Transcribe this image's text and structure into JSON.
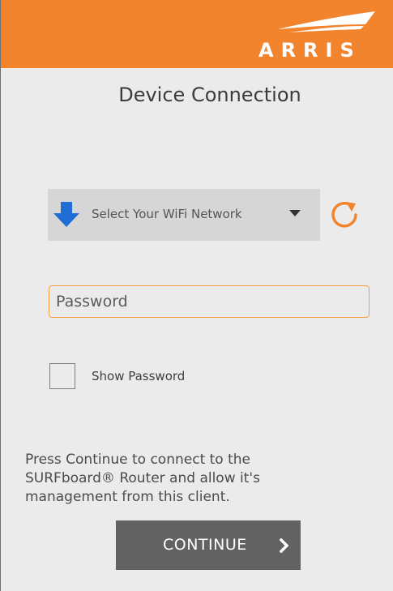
{
  "header": {
    "brand": "ARRIS",
    "background_color": "#f2842e"
  },
  "page": {
    "title": "Device Connection"
  },
  "network": {
    "select_label": "Select Your WiFi Network",
    "arrow_icon": "download-arrow-icon",
    "arrow_color": "#1e6ed6",
    "caret_icon": "caret-down-icon",
    "refresh_icon": "refresh-icon",
    "refresh_color": "#f2842e"
  },
  "password": {
    "placeholder": "Password",
    "value": "",
    "border_color": "#f0a142"
  },
  "show_password": {
    "label": "Show Password",
    "checked": false
  },
  "info": {
    "text": "Press Continue to connect to the SURFboard® Router and allow it's management from this client."
  },
  "continue": {
    "label": "CONTINUE",
    "icon": "chevron-right-icon",
    "background_color": "#626262"
  }
}
